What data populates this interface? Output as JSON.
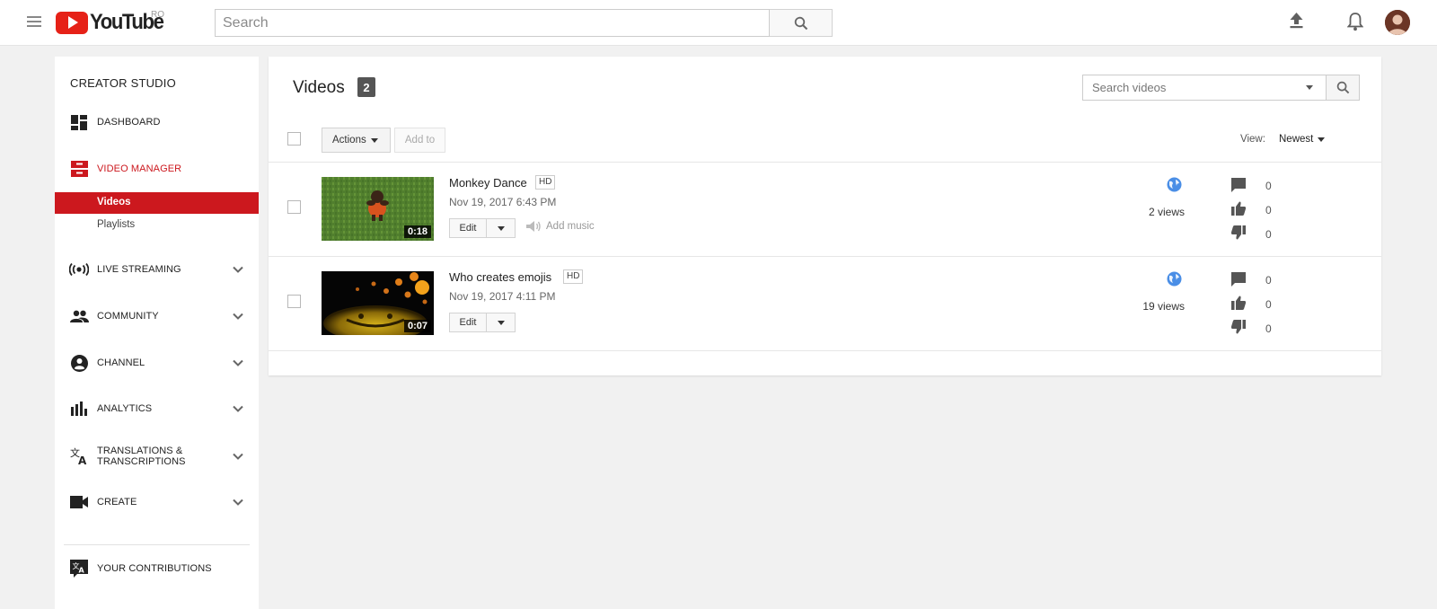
{
  "header": {
    "logo_text": "YouTube",
    "country_code": "RO",
    "search_placeholder": "Search"
  },
  "sidebar": {
    "title": "CREATOR STUDIO",
    "items": [
      {
        "label": "DASHBOARD",
        "icon": "dashboard-icon"
      },
      {
        "label": "VIDEO MANAGER",
        "icon": "video-manager-icon"
      },
      {
        "label": "LIVE STREAMING",
        "icon": "live-streaming-icon"
      },
      {
        "label": "COMMUNITY",
        "icon": "community-icon"
      },
      {
        "label": "CHANNEL",
        "icon": "channel-icon"
      },
      {
        "label": "ANALYTICS",
        "icon": "analytics-icon"
      },
      {
        "label": "TRANSLATIONS & TRANSCRIPTIONS",
        "icon": "translate-icon"
      },
      {
        "label": "CREATE",
        "icon": "create-icon"
      },
      {
        "label": "YOUR CONTRIBUTIONS",
        "icon": "contributions-icon"
      }
    ],
    "subitems": [
      {
        "label": "Videos"
      },
      {
        "label": "Playlists"
      }
    ]
  },
  "main": {
    "title": "Videos",
    "count": "2",
    "search_placeholder": "Search videos",
    "actions_label": "Actions",
    "add_to_label": "Add to",
    "view_label": "View:",
    "view_value": "Newest",
    "videos": [
      {
        "title": "Monkey Dance",
        "quality": "HD",
        "date": "Nov 19, 2017 6:43 PM",
        "duration": "0:18",
        "edit_label": "Edit",
        "add_music_label": "Add music",
        "views": "2 views",
        "comments": "0",
        "likes": "0",
        "dislikes": "0"
      },
      {
        "title": "Who creates emojis",
        "quality": "HD",
        "date": "Nov 19, 2017 4:11 PM",
        "duration": "0:07",
        "edit_label": "Edit",
        "views": "19 views",
        "comments": "0",
        "likes": "0",
        "dislikes": "0"
      }
    ]
  },
  "colors": {
    "brand_red": "#cc181e",
    "logo_red": "#e62117",
    "globe_blue": "#4a8ee6"
  }
}
